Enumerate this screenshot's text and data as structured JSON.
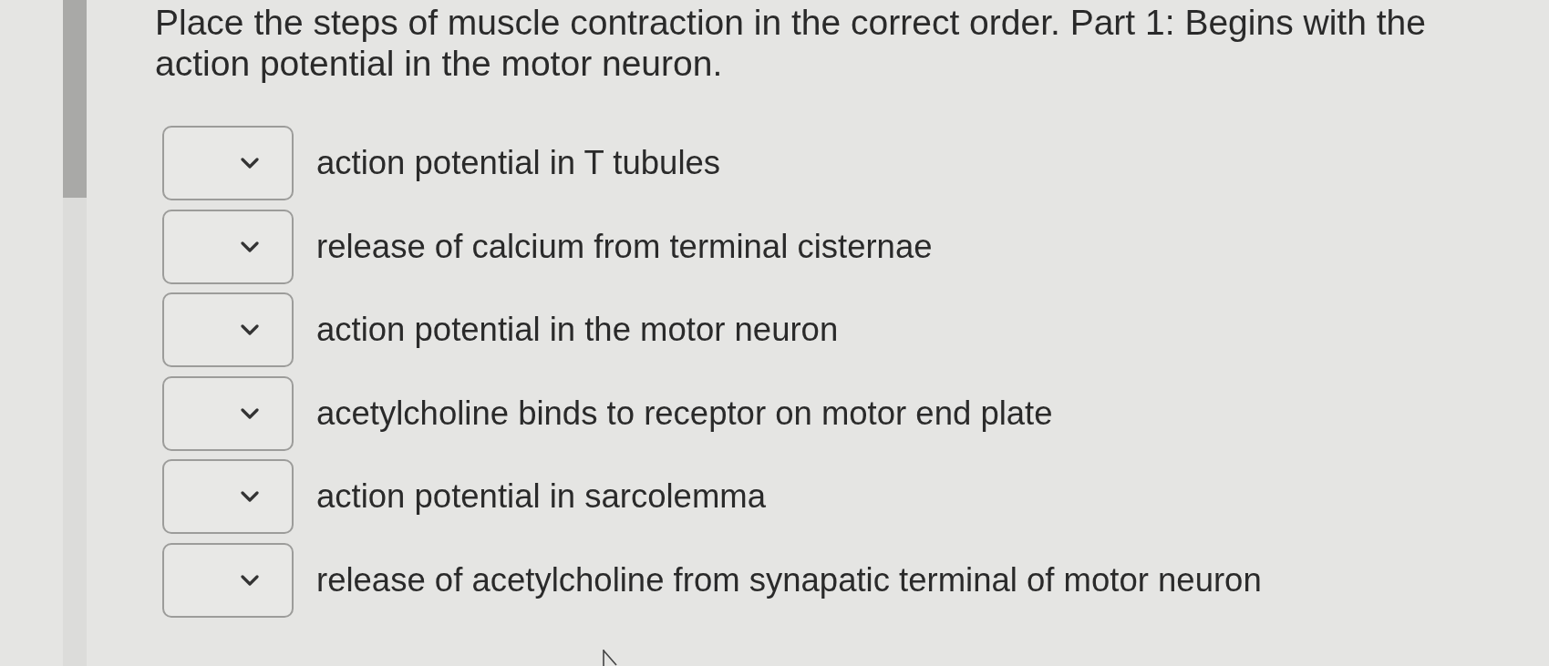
{
  "question": "Place the steps of muscle contraction in the correct order. Part 1: Begins with the action potential in the motor neuron.",
  "steps": [
    {
      "label": "action potential in T tubules"
    },
    {
      "label": "release of calcium from terminal cisternae"
    },
    {
      "label": "action potential in the motor neuron"
    },
    {
      "label": "acetylcholine binds to receptor on motor end plate"
    },
    {
      "label": "action potential in sarcolemma"
    },
    {
      "label": "release of acetylcholine from synapatic terminal of motor neuron"
    }
  ]
}
